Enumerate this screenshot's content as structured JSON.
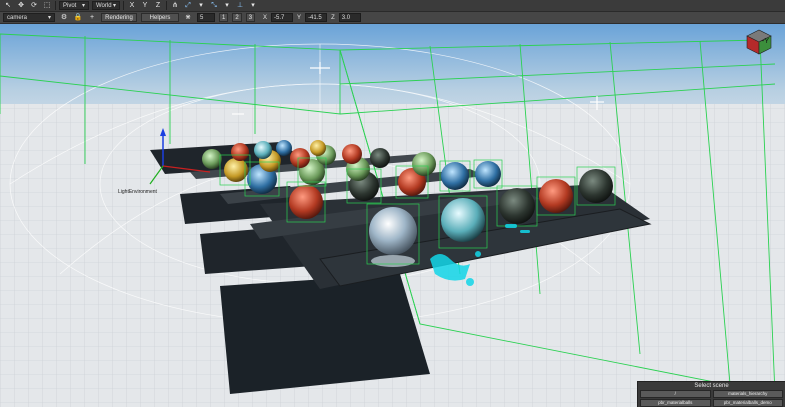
{
  "toolbar": {
    "pivot_label": "Pivot",
    "space_label": "World",
    "axis_x": "X",
    "axis_y": "Y",
    "axis_z": "Z"
  },
  "toolbar2": {
    "camera_value": "camera",
    "rendering_label": "Rendering",
    "helpers_label": "Helpers",
    "snap_value": "5",
    "view1": "1",
    "view2": "2",
    "view3": "3",
    "x_label": "X",
    "x_value": "-5.7",
    "y_label": "Y",
    "y_value": "-41.5",
    "z_label": "Z",
    "z_value": "3.0"
  },
  "viewport": {
    "overlay_text": "LightEnvironment",
    "gizmo_label": "-Y"
  },
  "scene_panel": {
    "title": "Select scene",
    "buttons": [
      "/",
      "materials_hierarchy",
      "pbr_materialballs",
      "pbr_materialballs_demo"
    ]
  }
}
